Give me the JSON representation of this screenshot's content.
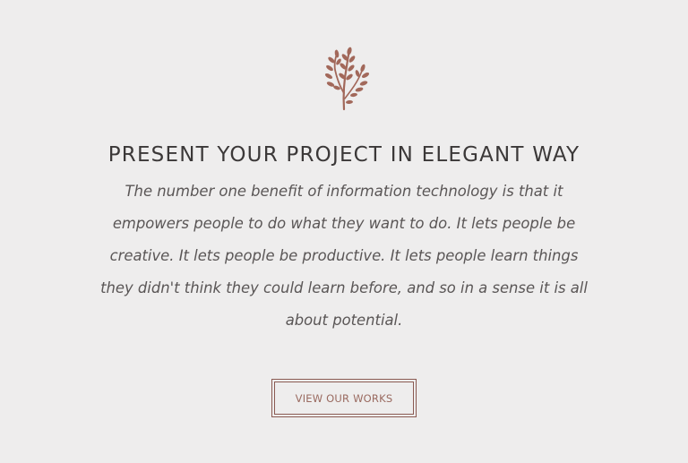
{
  "emblem": {
    "icon": "leaf-sprig-icon",
    "color": "#a2685a"
  },
  "heading": "PRESENT YOUR PROJECT IN ELEGANT WAY",
  "body": "The number one benefit of information technology is that it empowers people to do what they want to do. It lets people be creative. It lets people be productive. It lets people learn things they didn't think they could learn before, and so in a sense it is all about potential.",
  "cta": {
    "label": "VIEW OUR WORKS",
    "color": "#8a5a52"
  },
  "colors": {
    "background": "#eeeded",
    "heading": "#3b3838",
    "text": "#5a5656"
  }
}
